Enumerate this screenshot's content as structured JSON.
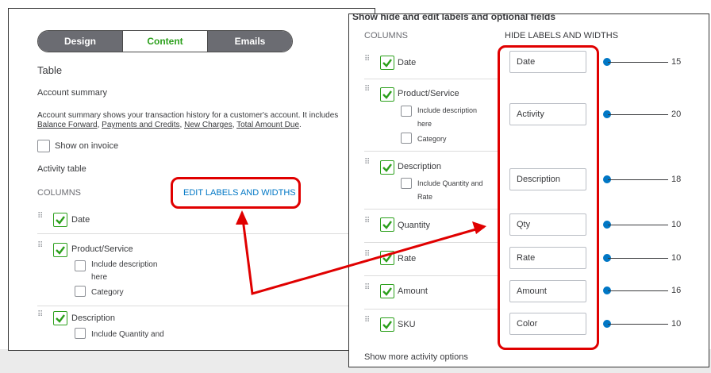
{
  "left_panel": {
    "tabs": [
      "Design",
      "Content",
      "Emails"
    ],
    "table_heading": "Table",
    "account_summary_heading": "Account summary",
    "account_summary_desc_line1": "Account summary shows your transaction history for a customer's account. It includes",
    "account_summary_desc_links": [
      "Balance Forward",
      "Payments and Credits",
      "New Charges",
      "Total Amount Due"
    ],
    "show_on_invoice": "Show on invoice",
    "activity_table": "Activity table",
    "columns_label": "COLUMNS",
    "edit_link": "EDIT LABELS AND WIDTHS",
    "rows": {
      "date": "Date",
      "product_service": "Product/Service",
      "include_description_1": "Include description",
      "include_description_2": "here",
      "category": "Category",
      "description": "Description",
      "include_quantity": "Include Quantity and"
    }
  },
  "right_panel": {
    "cut_heading": "Show hide and edit labels and optional fields",
    "columns_label": "COLUMNS",
    "hide_link": "HIDE LABELS AND WIDTHS",
    "rows": [
      {
        "name": "Date",
        "label_value": "Date",
        "width": "15"
      },
      {
        "name": "Product/Service",
        "label_value": "Activity",
        "width": "20",
        "sub": [
          "Include description",
          "here"
        ],
        "sub2": "Category"
      },
      {
        "name": "Description",
        "label_value": "Description",
        "width": "18",
        "sub": [
          "Include Quantity and",
          "Rate"
        ]
      },
      {
        "name": "Quantity",
        "label_value": "Qty",
        "width": "10"
      },
      {
        "name": "Rate",
        "label_value": "Rate",
        "width": "10"
      },
      {
        "name": "Amount",
        "label_value": "Amount",
        "width": "16"
      },
      {
        "name": "SKU",
        "label_value": "Color",
        "width": "10"
      }
    ],
    "more_link": "Show more activity options"
  },
  "colors": {
    "green": "#2ca01c",
    "blue": "#0077c5",
    "annotation_red": "#e00000",
    "tab_dark": "#6b6c72"
  }
}
